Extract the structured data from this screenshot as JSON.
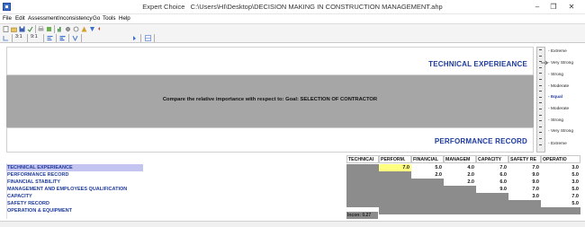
{
  "window": {
    "app_name": "Expert Choice",
    "file_path": "C:\\Users\\HI\\Desktop\\DECISION MAKING IN CONSTRUCTION MANAGEMENT.ahp",
    "min_glyph": "–",
    "max_glyph": "❐",
    "close_glyph": "✕"
  },
  "menu": {
    "items": [
      "File",
      "Edit",
      "Assessment",
      "Inconsistency",
      "Go",
      "Tools",
      "Help"
    ]
  },
  "toolbar2": {
    "labels": [
      "3:1",
      "9:1"
    ]
  },
  "comparison": {
    "top_criterion": "TECHNICAL EXPERIEANCE",
    "bottom_criterion": "PERFORMANCE RECORD",
    "prompt": "Compare the relative importance with respect to: Goal: SELECTION OF CONTRACTOR"
  },
  "verbal_scale": {
    "items": [
      "Extreme",
      "Very Strong",
      "Strong",
      "Moderate",
      "Equal",
      "Moderate",
      "Strong",
      "Very Strong",
      "Extreme"
    ],
    "selected_index": 4
  },
  "matrix": {
    "column_headers": [
      "TECHNICAI",
      "PERFORM.",
      "FINANCIAL",
      "MANAGEM",
      "CAPACITY",
      "SAFETY RE",
      "OPERATIO"
    ],
    "rows": [
      {
        "label": "TECHNICAL EXPERIEANCE",
        "cells": [
          "",
          "7.0",
          "5.0",
          "4.0",
          "7.0",
          "7.0",
          "3.0"
        ]
      },
      {
        "label": "PERFORMANCE RECORD",
        "cells": [
          "",
          "",
          "2.0",
          "2.0",
          "6.0",
          "9.0",
          "5.0"
        ]
      },
      {
        "label": "FINANCIAL STABILITY",
        "cells": [
          "",
          "",
          "",
          "2.0",
          "6.0",
          "9.0",
          "3.0"
        ]
      },
      {
        "label": "MANAGEMENT AND EMPLOYEES QUALIFICATION",
        "cells": [
          "",
          "",
          "",
          "",
          "9.0",
          "7.0",
          "5.0"
        ]
      },
      {
        "label": "CAPACITY",
        "cells": [
          "",
          "",
          "",
          "",
          "",
          "3.0",
          "7.0"
        ]
      },
      {
        "label": "SAFETY RECORD",
        "cells": [
          "",
          "",
          "",
          "",
          "",
          "",
          "5.0"
        ]
      },
      {
        "label": "OPERATION & EQUIPMENT",
        "cells": [
          "",
          "",
          "",
          "",
          "",
          "",
          ""
        ]
      }
    ],
    "selected_cell": {
      "row": 0,
      "col": 1
    },
    "inconsistency_label": "Incon: 0.27"
  },
  "colors": {
    "criterion_text": "#1e3a9c",
    "selected_row_highlight": "#c4c4f0",
    "selected_cell": "#ffff80",
    "panel_gray": "#a6a6a6",
    "diagonal_gray": "#8c8c8c"
  }
}
